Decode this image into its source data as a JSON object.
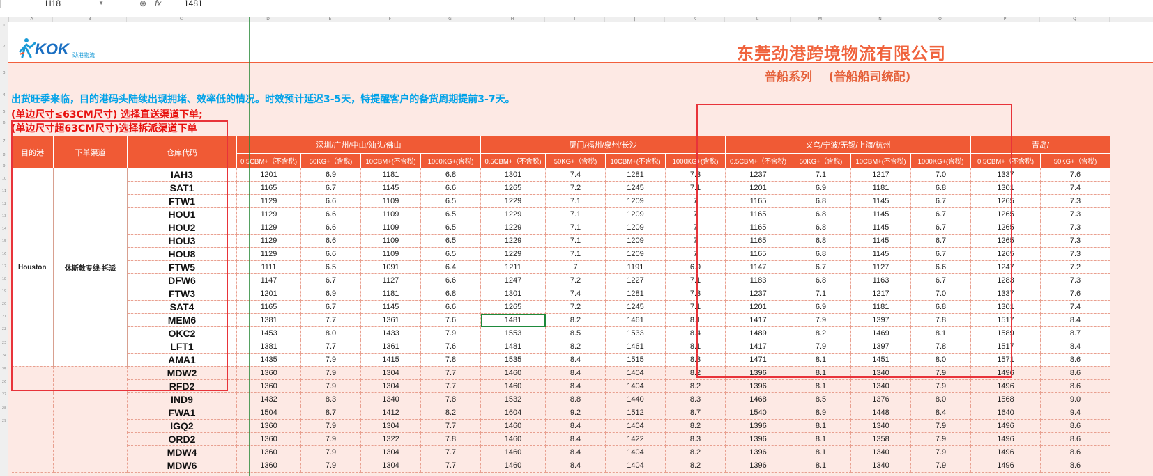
{
  "formula_bar": {
    "cell_ref": "H18",
    "zoom_icon": "zoom-icon",
    "fx_label": "fx",
    "value": "1481"
  },
  "columns": [
    {
      "letter": "A",
      "w": 48
    },
    {
      "letter": "B",
      "w": 110
    },
    {
      "letter": "C",
      "w": 166
    },
    {
      "letter": "D",
      "w": 98
    },
    {
      "letter": "E",
      "w": 90
    },
    {
      "letter": "F",
      "w": 90
    },
    {
      "letter": "G",
      "w": 90
    },
    {
      "letter": "H",
      "w": 98
    },
    {
      "letter": "I",
      "w": 90
    },
    {
      "letter": "J",
      "w": 90
    },
    {
      "letter": "K",
      "w": 90
    },
    {
      "letter": "L",
      "w": 100
    },
    {
      "letter": "M",
      "w": 90
    },
    {
      "letter": "N",
      "w": 90
    },
    {
      "letter": "O",
      "w": 90
    },
    {
      "letter": "P",
      "w": 106
    },
    {
      "letter": "Q",
      "w": 90
    }
  ],
  "rows": [
    "1",
    "2",
    "3",
    "4",
    "5",
    "6",
    "7",
    "8",
    "9",
    "10",
    "11",
    "12",
    "13",
    "14",
    "15",
    "16",
    "17",
    "18",
    "19",
    "20",
    "21",
    "22",
    "23",
    "24",
    "25",
    "26",
    "27",
    "28",
    "29"
  ],
  "header": {
    "company": "东莞劲港跨境物流有限公司",
    "subtitle": "普船系列    (普船船司统配)",
    "logo_text": "KOK",
    "logo_sub": "劲港物流"
  },
  "notes": {
    "line1": "出货旺季来临，目的港码头陆续出现拥堵、效率低的情况。时效预计延迟3-5天，特提醒客户的备货周期提前3-7天。",
    "line2": "(单边尺寸≤63CM尺寸) 选择直送渠道下单;",
    "line3": "(单边尺寸超63CM尺寸)选择拆派渠道下单"
  },
  "table": {
    "h_dest": "目的港",
    "h_channel": "下单渠道",
    "h_warehouse": "仓库代码",
    "groups": [
      "深圳/广州/中山/汕头/佛山",
      "厦门/福州/泉州/长沙",
      "义乌/宁波/无锡/上海/杭州",
      "青岛/"
    ],
    "sub_headers": [
      "0.5CBM+（不含税)",
      "50KG+（含税)",
      "10CBM+(不含税)",
      "1000KG+(含税)",
      "0.5CBM+（不含税)",
      "50KG+（含税)",
      "10CBM+(不含税)",
      "1000KG+(含税)",
      "0.5CBM+（不含税)",
      "50KG+（含税)",
      "10CBM+(不含税)",
      "1000KG+(含税)",
      "0.5CBM+（不含税)",
      "50KG+（含税)"
    ],
    "group1_dest": "Houston",
    "group1_channel": "休斯敦专线-拆派",
    "group1": [
      {
        "wh": "IAH3",
        "v": [
          "1201",
          "6.9",
          "1181",
          "6.8",
          "1301",
          "7.4",
          "1281",
          "7.3",
          "1237",
          "7.1",
          "1217",
          "7.0",
          "1337",
          "7.6"
        ]
      },
      {
        "wh": "SAT1",
        "v": [
          "1165",
          "6.7",
          "1145",
          "6.6",
          "1265",
          "7.2",
          "1245",
          "7.1",
          "1201",
          "6.9",
          "1181",
          "6.8",
          "1301",
          "7.4"
        ]
      },
      {
        "wh": "FTW1",
        "v": [
          "1129",
          "6.6",
          "1109",
          "6.5",
          "1229",
          "7.1",
          "1209",
          "7",
          "1165",
          "6.8",
          "1145",
          "6.7",
          "1265",
          "7.3"
        ]
      },
      {
        "wh": "HOU1",
        "v": [
          "1129",
          "6.6",
          "1109",
          "6.5",
          "1229",
          "7.1",
          "1209",
          "7",
          "1165",
          "6.8",
          "1145",
          "6.7",
          "1265",
          "7.3"
        ]
      },
      {
        "wh": "HOU2",
        "v": [
          "1129",
          "6.6",
          "1109",
          "6.5",
          "1229",
          "7.1",
          "1209",
          "7",
          "1165",
          "6.8",
          "1145",
          "6.7",
          "1265",
          "7.3"
        ]
      },
      {
        "wh": "HOU3",
        "v": [
          "1129",
          "6.6",
          "1109",
          "6.5",
          "1229",
          "7.1",
          "1209",
          "7",
          "1165",
          "6.8",
          "1145",
          "6.7",
          "1265",
          "7.3"
        ]
      },
      {
        "wh": "HOU8",
        "v": [
          "1129",
          "6.6",
          "1109",
          "6.5",
          "1229",
          "7.1",
          "1209",
          "7",
          "1165",
          "6.8",
          "1145",
          "6.7",
          "1265",
          "7.3"
        ]
      },
      {
        "wh": "FTW5",
        "v": [
          "1111",
          "6.5",
          "1091",
          "6.4",
          "1211",
          "7",
          "1191",
          "6.9",
          "1147",
          "6.7",
          "1127",
          "6.6",
          "1247",
          "7.2"
        ]
      },
      {
        "wh": "DFW6",
        "v": [
          "1147",
          "6.7",
          "1127",
          "6.6",
          "1247",
          "7.2",
          "1227",
          "7.1",
          "1183",
          "6.8",
          "1163",
          "6.7",
          "1283",
          "7.3"
        ]
      },
      {
        "wh": "FTW3",
        "v": [
          "1201",
          "6.9",
          "1181",
          "6.8",
          "1301",
          "7.4",
          "1281",
          "7.3",
          "1237",
          "7.1",
          "1217",
          "7.0",
          "1337",
          "7.6"
        ]
      },
      {
        "wh": "SAT4",
        "v": [
          "1165",
          "6.7",
          "1145",
          "6.6",
          "1265",
          "7.2",
          "1245",
          "7.1",
          "1201",
          "6.9",
          "1181",
          "6.8",
          "1301",
          "7.4"
        ]
      },
      {
        "wh": "MEM6",
        "v": [
          "1381",
          "7.7",
          "1361",
          "7.6",
          "1481",
          "8.2",
          "1461",
          "8.1",
          "1417",
          "7.9",
          "1397",
          "7.8",
          "1517",
          "8.4"
        ]
      },
      {
        "wh": "OKC2",
        "v": [
          "1453",
          "8.0",
          "1433",
          "7.9",
          "1553",
          "8.5",
          "1533",
          "8.4",
          "1489",
          "8.2",
          "1469",
          "8.1",
          "1589",
          "8.7"
        ]
      },
      {
        "wh": "LFT1",
        "v": [
          "1381",
          "7.7",
          "1361",
          "7.6",
          "1481",
          "8.2",
          "1461",
          "8.1",
          "1417",
          "7.9",
          "1397",
          "7.8",
          "1517",
          "8.4"
        ]
      },
      {
        "wh": "AMA1",
        "v": [
          "1435",
          "7.9",
          "1415",
          "7.8",
          "1535",
          "8.4",
          "1515",
          "8.3",
          "1471",
          "8.1",
          "1451",
          "8.0",
          "1571",
          "8.6"
        ]
      }
    ],
    "group2": [
      {
        "wh": "MDW2",
        "v": [
          "1360",
          "7.9",
          "1304",
          "7.7",
          "1460",
          "8.4",
          "1404",
          "8.2",
          "1396",
          "8.1",
          "1340",
          "7.9",
          "1496",
          "8.6"
        ]
      },
      {
        "wh": "RFD2",
        "v": [
          "1360",
          "7.9",
          "1304",
          "7.7",
          "1460",
          "8.4",
          "1404",
          "8.2",
          "1396",
          "8.1",
          "1340",
          "7.9",
          "1496",
          "8.6"
        ]
      },
      {
        "wh": "IND9",
        "v": [
          "1432",
          "8.3",
          "1340",
          "7.8",
          "1532",
          "8.8",
          "1440",
          "8.3",
          "1468",
          "8.5",
          "1376",
          "8.0",
          "1568",
          "9.0"
        ]
      },
      {
        "wh": "FWA1",
        "v": [
          "1504",
          "8.7",
          "1412",
          "8.2",
          "1604",
          "9.2",
          "1512",
          "8.7",
          "1540",
          "8.9",
          "1448",
          "8.4",
          "1640",
          "9.4"
        ]
      },
      {
        "wh": "IGQ2",
        "v": [
          "1360",
          "7.9",
          "1304",
          "7.7",
          "1460",
          "8.4",
          "1404",
          "8.2",
          "1396",
          "8.1",
          "1340",
          "7.9",
          "1496",
          "8.6"
        ]
      },
      {
        "wh": "ORD2",
        "v": [
          "1360",
          "7.9",
          "1322",
          "7.8",
          "1460",
          "8.4",
          "1422",
          "8.3",
          "1396",
          "8.1",
          "1358",
          "7.9",
          "1496",
          "8.6"
        ]
      },
      {
        "wh": "MDW4",
        "v": [
          "1360",
          "7.9",
          "1304",
          "7.7",
          "1460",
          "8.4",
          "1404",
          "8.2",
          "1396",
          "8.1",
          "1340",
          "7.9",
          "1496",
          "8.6"
        ]
      },
      {
        "wh": "MDW6",
        "v": [
          "1360",
          "7.9",
          "1304",
          "7.7",
          "1460",
          "8.4",
          "1404",
          "8.2",
          "1396",
          "8.1",
          "1340",
          "7.9",
          "1496",
          "8.6"
        ]
      }
    ]
  },
  "colors": {
    "accent": "#f05a35",
    "note_blue": "#00a2e8",
    "note_red": "#e8120f",
    "annotation": "#e8333a",
    "selection": "#1e8a3b"
  }
}
